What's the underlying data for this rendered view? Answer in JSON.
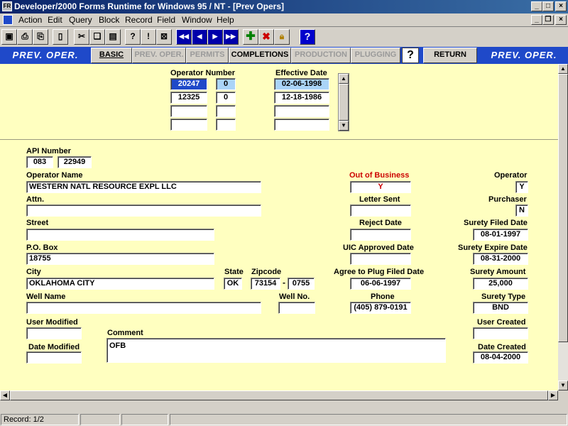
{
  "window": {
    "title": "Developer/2000 Forms Runtime for Windows 95 / NT - [Prev Opers]",
    "app_icon_text": "FR"
  },
  "menu": [
    "Action",
    "Edit",
    "Query",
    "Block",
    "Record",
    "Field",
    "Window",
    "Help"
  ],
  "toolbar": {
    "icons": [
      "save-icon",
      "print-icon",
      "print-setup-icon",
      "exit-icon",
      "cut-icon",
      "copy-icon",
      "paste-icon",
      "enter-query-icon",
      "execute-query-icon",
      "cancel-query-icon",
      "first-record-icon",
      "previous-record-icon",
      "next-record-icon",
      "last-record-icon",
      "insert-record-icon",
      "delete-record-icon",
      "lock-record-icon",
      "help-icon"
    ]
  },
  "nav": {
    "title_left": "PREV. OPER.",
    "title_right": "PREV. OPER.",
    "buttons": [
      "BASIC",
      "PREV. OPER.",
      "PERMITS",
      "COMPLETIONS",
      "PRODUCTION",
      "PLUGGING"
    ],
    "help": "?",
    "return": "RETURN"
  },
  "prev_block": {
    "operator_number_label": "Operator Number",
    "effective_date_label": "Effective Date",
    "rows": [
      {
        "operator": "20247",
        "suffix": "0",
        "date": "02-06-1998"
      },
      {
        "operator": "12325",
        "suffix": "0",
        "date": "12-18-1986"
      },
      {
        "operator": "",
        "suffix": "",
        "date": ""
      },
      {
        "operator": "",
        "suffix": "",
        "date": ""
      }
    ]
  },
  "form": {
    "api_number_label": "API Number",
    "api_county": "083",
    "api_number": "22949",
    "operator_name_label": "Operator Name",
    "operator_name": "WESTERN NATL RESOURCE EXPL LLC",
    "attn_label": "Attn.",
    "attn": "",
    "street_label": "Street",
    "street": "",
    "po_box_label": "P.O. Box",
    "po_box": "18755",
    "city_label": "City",
    "city": "OKLAHOMA CITY",
    "state_label": "State",
    "state": "OK",
    "zipcode_label": "Zipcode",
    "zip": "73154",
    "zip_dash": "-",
    "zip_ext": "0755",
    "well_name_label": "Well Name",
    "well_name": "",
    "well_no_label": "Well No.",
    "well_no": "",
    "user_modified_label": "User Modified",
    "user_modified": "",
    "date_modified_label": "Date Modified",
    "date_modified": "",
    "comment_label": "Comment",
    "comment": "OFB",
    "out_of_business_label": "Out of Business",
    "out_of_business": "Y",
    "letter_sent_label": "Letter Sent",
    "letter_sent": "",
    "reject_date_label": "Reject Date",
    "reject_date": "",
    "uic_approved_label": "UIC Approved Date",
    "uic_approved": "",
    "agree_plug_label": "Agree to Plug Filed Date",
    "agree_plug": "06-06-1997",
    "phone_label": "Phone",
    "phone": "(405) 879-0191",
    "operator_flag_label": "Operator",
    "operator_flag": "Y",
    "purchaser_label": "Purchaser",
    "purchaser": "N",
    "surety_filed_label": "Surety Filed Date",
    "surety_filed": "08-01-1997",
    "surety_expire_label": "Surety Expire Date",
    "surety_expire": "08-31-2000",
    "surety_amount_label": "Surety Amount",
    "surety_amount": "25,000",
    "surety_type_label": "Surety Type",
    "surety_type": "BND",
    "user_created_label": "User Created",
    "user_created": "",
    "date_created_label": "Date Created",
    "date_created": "08-04-2000"
  },
  "status": {
    "record": "Record: 1/2"
  }
}
